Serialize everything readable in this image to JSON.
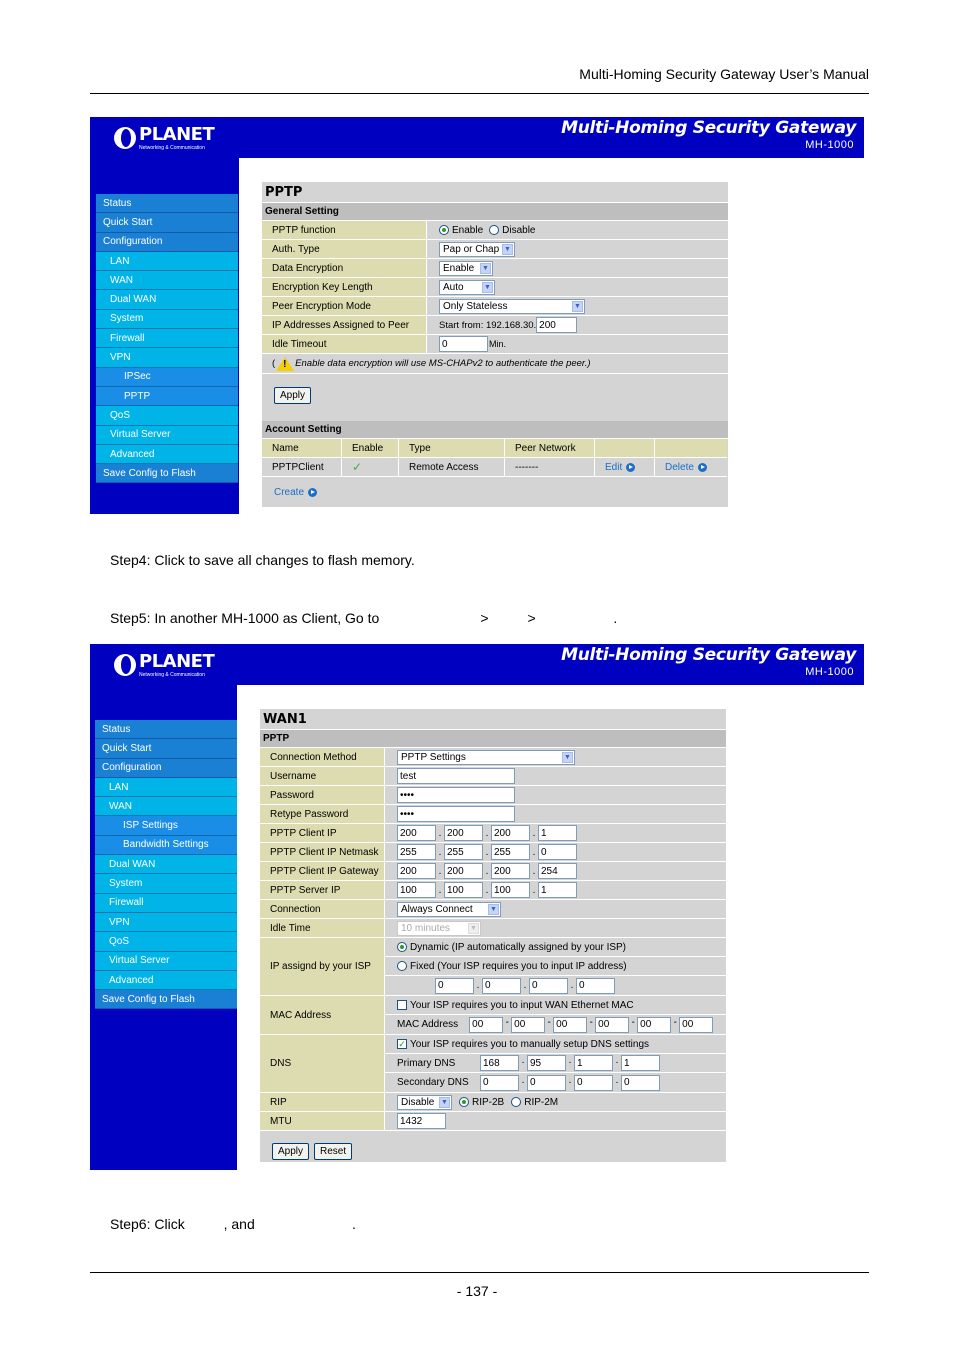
{
  "doc": {
    "header": "Multi-Homing  Security  Gateway  User’s  Manual",
    "step4": "Step4: Click                     to save all changes to flash memory.",
    "step5": "Step5: In another MH-1000 as Client, Go to                          >          >                    .",
    "step6": "Step6: Click          , and                         .",
    "page_number": "- 137 -"
  },
  "banner": {
    "logo_name": "PLANET",
    "logo_sub": "Networking & Communication",
    "title": "Multi-Homing Security Gateway",
    "model": "MH-1000"
  },
  "colors": {
    "banner_bg": "#0000c0",
    "nav_top": "#1a80d4",
    "nav_sub": "#00b4e8",
    "nav_sub2": "#1a8ee6",
    "label_bg": "#dcdcb0",
    "panel_bg": "#d4d4d4",
    "link": "#1a6ec8"
  },
  "screen1": {
    "sidebar": [
      {
        "label": "Status",
        "level": 0
      },
      {
        "label": "Quick Start",
        "level": 0
      },
      {
        "label": "Configuration",
        "level": 0
      },
      {
        "label": "LAN",
        "level": 1
      },
      {
        "label": "WAN",
        "level": 1
      },
      {
        "label": "Dual WAN",
        "level": 1
      },
      {
        "label": "System",
        "level": 1
      },
      {
        "label": "Firewall",
        "level": 1
      },
      {
        "label": "VPN",
        "level": 1
      },
      {
        "label": "IPSec",
        "level": 2
      },
      {
        "label": "PPTP",
        "level": 2
      },
      {
        "label": "QoS",
        "level": 1
      },
      {
        "label": "Virtual Server",
        "level": 1
      },
      {
        "label": "Advanced",
        "level": 1
      },
      {
        "label": "Save Config to Flash",
        "level": 0
      }
    ],
    "panel_title": "PPTP",
    "general_title": "General Setting",
    "pptp_function": {
      "label": "PPTP function",
      "options": [
        "Enable",
        "Disable"
      ],
      "selected": "Enable"
    },
    "auth_type": {
      "label": "Auth. Type",
      "value": "Pap or Chap"
    },
    "data_encryption": {
      "label": "Data Encryption",
      "value": "Enable"
    },
    "key_length": {
      "label": "Encryption Key Length",
      "value": "Auto"
    },
    "peer_mode": {
      "label": "Peer Encryption Mode",
      "value": "Only Stateless"
    },
    "ip_assigned": {
      "label": "IP Addresses Assigned to Peer",
      "prefix": "Start from: 192.168.30.",
      "value": "200"
    },
    "idle_timeout": {
      "label": "Idle Timeout",
      "value": "0",
      "unit": "Min."
    },
    "note_open": "(",
    "note": "Enable data encryption will use MS-CHAPv2 to authenticate the peer.)",
    "apply": "Apply",
    "account_title": "Account Setting",
    "account_headers": [
      "Name",
      "Enable",
      "Type",
      "Peer Network",
      "",
      ""
    ],
    "account_rows": [
      {
        "name": "PPTPClient",
        "enabled": true,
        "type": "Remote Access",
        "peer": "-------",
        "edit": "Edit",
        "delete": "Delete"
      }
    ],
    "create": "Create"
  },
  "screen2": {
    "sidebar": [
      {
        "label": "Status",
        "level": 0
      },
      {
        "label": "Quick Start",
        "level": 0
      },
      {
        "label": "Configuration",
        "level": 0
      },
      {
        "label": "LAN",
        "level": 1
      },
      {
        "label": "WAN",
        "level": 1
      },
      {
        "label": "ISP Settings",
        "level": 2
      },
      {
        "label": "Bandwidth Settings",
        "level": 2
      },
      {
        "label": "Dual WAN",
        "level": 1
      },
      {
        "label": "System",
        "level": 1
      },
      {
        "label": "Firewall",
        "level": 1
      },
      {
        "label": "VPN",
        "level": 1
      },
      {
        "label": "QoS",
        "level": 1
      },
      {
        "label": "Virtual Server",
        "level": 1
      },
      {
        "label": "Advanced",
        "level": 1
      },
      {
        "label": "Save Config to Flash",
        "level": 0
      }
    ],
    "panel_title": "WAN1",
    "section_title": "PPTP",
    "connection_method": {
      "label": "Connection Method",
      "value": "PPTP Settings"
    },
    "username": {
      "label": "Username",
      "value": "test"
    },
    "password": {
      "label": "Password",
      "value": "••••"
    },
    "retype_password": {
      "label": "Retype Password",
      "value": "••••"
    },
    "client_ip": {
      "label": "PPTP Client IP",
      "octets": [
        "200",
        "200",
        "200",
        "1"
      ]
    },
    "client_netmask": {
      "label": "PPTP Client IP Netmask",
      "octets": [
        "255",
        "255",
        "255",
        "0"
      ]
    },
    "client_gateway": {
      "label": "PPTP Client IP Gateway",
      "octets": [
        "200",
        "200",
        "200",
        "254"
      ]
    },
    "server_ip": {
      "label": "PPTP Server IP",
      "octets": [
        "100",
        "100",
        "100",
        "1"
      ]
    },
    "connection": {
      "label": "Connection",
      "value": "Always Connect"
    },
    "idle_time": {
      "label": "Idle Time",
      "value": "10 minutes"
    },
    "ip_assign": {
      "label": "IP assignd by your ISP",
      "dynamic": "Dynamic (IP automatically assigned by your ISP)",
      "fixed": "Fixed (Your ISP requires you to input IP address)",
      "selected": "dynamic",
      "octets": [
        "0",
        "0",
        "0",
        "0"
      ]
    },
    "mac": {
      "label": "MAC Address",
      "checkbox": "Your ISP requires you to input WAN Ethernet MAC",
      "checked": false,
      "field_label": "MAC Address",
      "octets": [
        "00",
        "00",
        "00",
        "00",
        "00",
        "00"
      ]
    },
    "dns": {
      "label": "DNS",
      "checkbox": "Your ISP requires you to manually setup DNS settings",
      "checked": true,
      "primary_label": "Primary DNS",
      "primary": [
        "168",
        "95",
        "1",
        "1"
      ],
      "secondary_label": "Secondary DNS",
      "secondary": [
        "0",
        "0",
        "0",
        "0"
      ]
    },
    "rip": {
      "label": "RIP",
      "value": "Disable",
      "options": [
        "RIP-2B",
        "RIP-2M"
      ],
      "selected": "RIP-2B"
    },
    "mtu": {
      "label": "MTU",
      "value": "1432"
    },
    "apply": "Apply",
    "reset": "Reset"
  }
}
